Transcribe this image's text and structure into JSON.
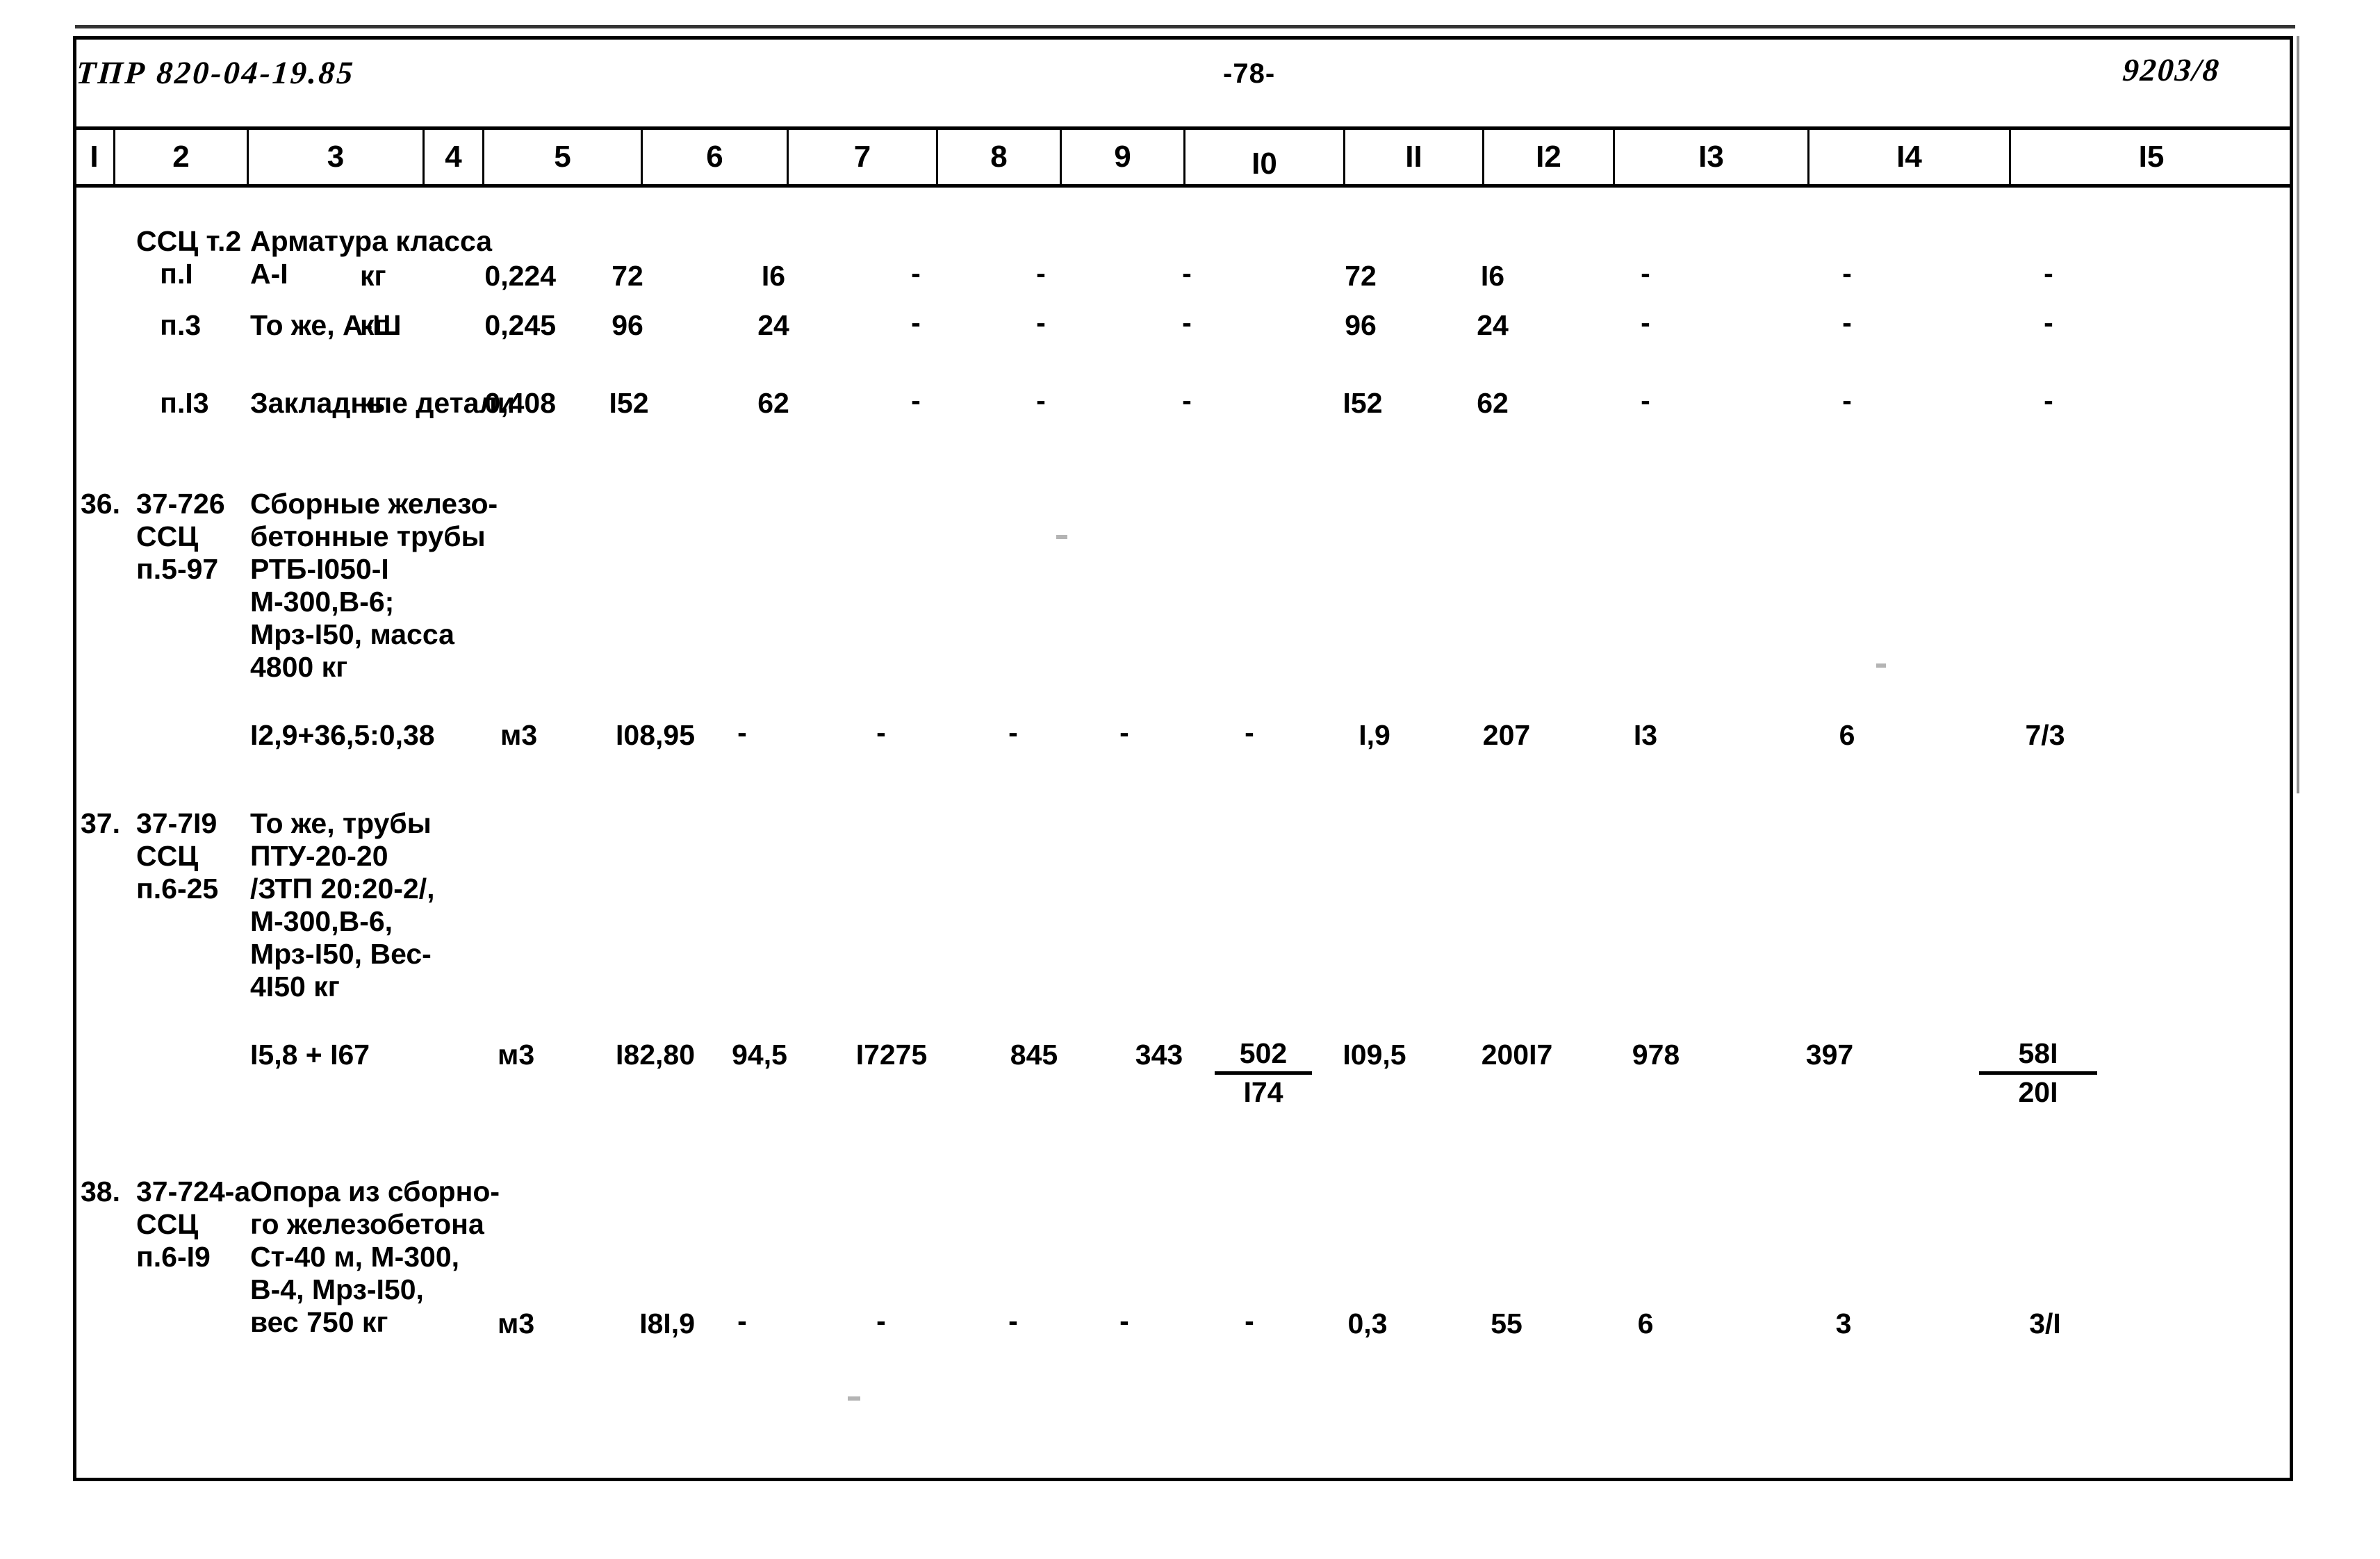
{
  "document": {
    "code": "ТПР 820-04-19.85",
    "page_number": "-78-",
    "sheet_number": "9203/8"
  },
  "table": {
    "column_headers": [
      "I",
      "2",
      "3",
      "4",
      "5",
      "6",
      "7",
      "8",
      "9",
      "I0",
      "II",
      "I2",
      "I3",
      "I4",
      "I5"
    ],
    "rows": [
      {
        "no": "",
        "code": "ССЦ т.2\n   п.I",
        "description": "Арматура класса\n         А-I",
        "unit": "кг",
        "c5": "0,224",
        "c6": "72",
        "c7": "I6",
        "c8": "-",
        "c9": "-",
        "c10": "-",
        "c11": "72",
        "c12": "I6",
        "c13": "-",
        "c14": "-",
        "c15": "-"
      },
      {
        "no": "",
        "code": "   п.3",
        "description": "То же, А-Ш",
        "unit": "кг",
        "c5": "0,245",
        "c6": "96",
        "c7": "24",
        "c8": "-",
        "c9": "-",
        "c10": "-",
        "c11": "96",
        "c12": "24",
        "c13": "-",
        "c14": "-",
        "c15": "-"
      },
      {
        "no": "",
        "code": "   п.I3",
        "description": "Закладные детали",
        "unit": "кг",
        "c5": "0,408",
        "c6": "I52",
        "c7": "62",
        "c8": "-",
        "c9": "-",
        "c10": "-",
        "c11": "I52",
        "c12": "62",
        "c13": "-",
        "c14": "-",
        "c15": "-"
      },
      {
        "no": "36.",
        "code": "37-726\nССЦ\nп.5-97",
        "description": "Сборные железо-\nбетонные трубы\nРТБ-I050-I\nМ-300,В-6;\nМрз-I50, масса\n4800 кг",
        "formula": "I2,9+36,5:0,38",
        "unit": "м3",
        "c5": "I08,95",
        "c6": "-",
        "c7": "-",
        "c8": "-",
        "c9": "-",
        "c10": "-",
        "c11": "I,9",
        "c12": "207",
        "c13": "I3",
        "c14": "6",
        "c15": "7/3"
      },
      {
        "no": "37.",
        "code": "37-7I9\nССЦ\nп.6-25",
        "description": "То же, трубы\nПТУ-20-20\n/ЗТП 20:20-2/,\nМ-300,В-6,\nМрз-I50, Вес-\n4I50 кг",
        "formula": "I5,8 + I67",
        "unit": "м3",
        "c5": "I82,80",
        "c6": "94,5",
        "c7": "I7275",
        "c8": "845",
        "c9": "343",
        "c10_num": "502",
        "c10_den": "I74",
        "c11": "I09,5",
        "c12": "200I7",
        "c13": "978",
        "c14": "397",
        "c15_num": "58I",
        "c15_den": "20I"
      },
      {
        "no": "38.",
        "code": "37-724-а\nССЦ\nп.6-I9",
        "description": "Опора из сборно-\nго железобетона\nСт-40 м, М-300,\nВ-4, Мрз-I50,\nвес 750 кг",
        "unit": "м3",
        "c5": "I8I,9",
        "c6": "-",
        "c7": "-",
        "c8": "-",
        "c9": "-",
        "c10": "-",
        "c11": "0,3",
        "c12": "55",
        "c13": "6",
        "c14": "3",
        "c15": "3/I"
      }
    ]
  }
}
